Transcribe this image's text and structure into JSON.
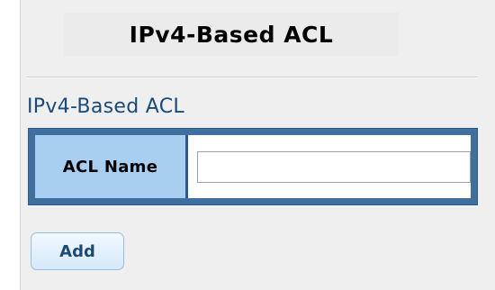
{
  "header": {
    "title": "IPv4-Based ACL"
  },
  "section": {
    "title": "IPv4-Based ACL"
  },
  "form": {
    "acl_name_label": "ACL Name",
    "acl_name_value": ""
  },
  "actions": {
    "add_label": "Add"
  },
  "colors": {
    "panel_background": "#efefef",
    "section_title": "#1b4a78",
    "table_border": "#3f6f9f",
    "label_cell": "#a9cff0",
    "button_border": "#98bde0"
  }
}
